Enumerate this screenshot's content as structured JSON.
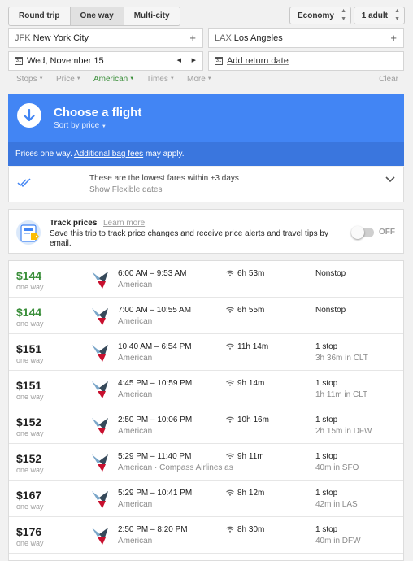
{
  "trip_types": [
    "Round trip",
    "One way",
    "Multi-city"
  ],
  "cabin_class": "Economy",
  "passengers": "1 adult",
  "origin": {
    "code": "JFK",
    "city": "New York City"
  },
  "destination": {
    "code": "LAX",
    "city": "Los Angeles"
  },
  "departure_date": "Wed, November 15",
  "return_placeholder": "Add return date",
  "calendar_glyph": "31",
  "filters": [
    "Stops",
    "Price",
    "American",
    "Times",
    "More"
  ],
  "clear_label": "Clear",
  "choose": {
    "title": "Choose a flight",
    "sort_label": "Sort by price",
    "notice_prefix": "Prices one way.",
    "notice_link": "Additional bag fees",
    "notice_suffix": "may apply."
  },
  "flexible": {
    "line1": "These are the lowest fares within ±3 days",
    "line2": "Show Flexible dates"
  },
  "track": {
    "title": "Track prices",
    "learn_more": "Learn more",
    "description": "Save this trip to track price changes and receive price alerts and travel tips by email.",
    "toggle_label": "OFF"
  },
  "flights": [
    {
      "price": "$144",
      "price_label": "one way",
      "times": "6:00 AM – 9:53 AM",
      "airline": "American",
      "duration": "6h 53m",
      "stops": "Nonstop",
      "stop_detail": ""
    },
    {
      "price": "$144",
      "price_label": "one way",
      "times": "7:00 AM – 10:55 AM",
      "airline": "American",
      "duration": "6h 55m",
      "stops": "Nonstop",
      "stop_detail": ""
    },
    {
      "price": "$151",
      "price_label": "one way",
      "times": "10:40 AM – 6:54 PM",
      "airline": "American",
      "duration": "11h 14m",
      "stops": "1 stop",
      "stop_detail": "3h 36m in CLT"
    },
    {
      "price": "$151",
      "price_label": "one way",
      "times": "4:45 PM – 10:59 PM",
      "airline": "American",
      "duration": "9h 14m",
      "stops": "1 stop",
      "stop_detail": "1h 11m in CLT"
    },
    {
      "price": "$152",
      "price_label": "one way",
      "times": "2:50 PM – 10:06 PM",
      "airline": "American",
      "duration": "10h 16m",
      "stops": "1 stop",
      "stop_detail": "2h 15m in DFW"
    },
    {
      "price": "$152",
      "price_label": "one way",
      "times": "5:29 PM – 11:40 PM",
      "airline": "American · Compass Airlines as",
      "duration": "9h 11m",
      "stops": "1 stop",
      "stop_detail": "40m in SFO"
    },
    {
      "price": "$167",
      "price_label": "one way",
      "times": "5:29 PM – 10:41 PM",
      "airline": "American",
      "duration": "8h 12m",
      "stops": "1 stop",
      "stop_detail": "42m in LAS"
    },
    {
      "price": "$176",
      "price_label": "one way",
      "times": "2:50 PM – 8:20 PM",
      "airline": "American",
      "duration": "8h 30m",
      "stops": "1 stop",
      "stop_detail": "40m in DFW"
    }
  ],
  "colors": {
    "accent_blue": "#4285f4",
    "price_green": "#3b8f3b",
    "filter_active": "#3b8f3b"
  }
}
